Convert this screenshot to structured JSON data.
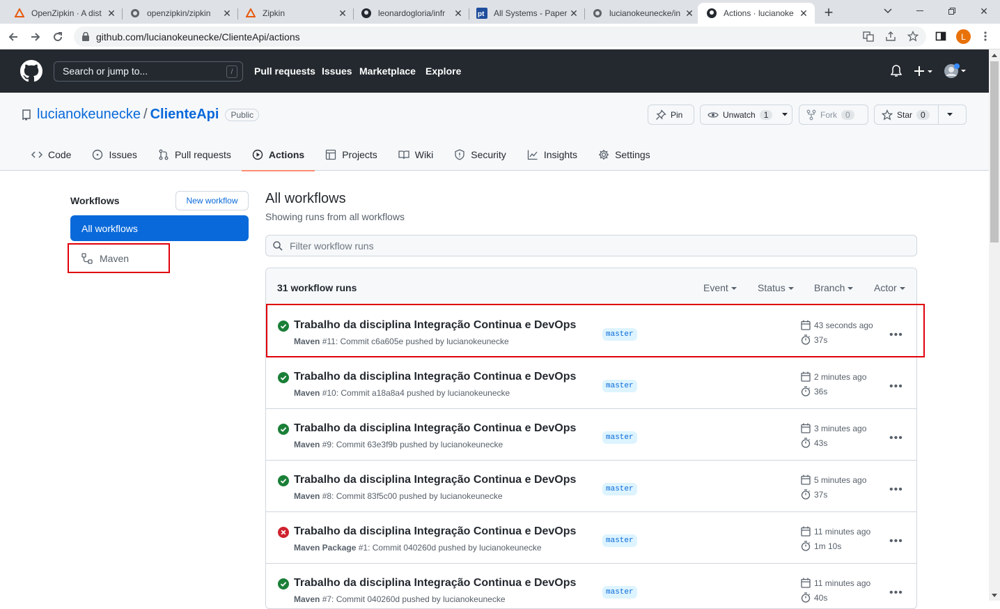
{
  "browser": {
    "tabs": [
      {
        "title": "OpenZipkin · A dist",
        "icon": "zipkin-icon"
      },
      {
        "title": "openzipkin/zipkin",
        "icon": "globe-icon"
      },
      {
        "title": "Zipkin",
        "icon": "zipkin-icon"
      },
      {
        "title": "leonardogloria/infr",
        "icon": "github-icon"
      },
      {
        "title": "All Systems - Paper",
        "icon": "pt-icon"
      },
      {
        "title": "lucianokeunecke/in",
        "icon": "globe-icon"
      },
      {
        "title": "Actions · lucianoke",
        "icon": "github-icon",
        "active": true
      }
    ],
    "url": "github.com/lucianokeunecke/ClienteApi/actions",
    "profile_initial": "L"
  },
  "gh_header": {
    "search_placeholder": "Search or jump to...",
    "search_shortcut": "/",
    "nav": [
      "Pull requests",
      "Issues",
      "Marketplace",
      "Explore"
    ]
  },
  "repo": {
    "owner": "lucianokeunecke",
    "separator": "/",
    "name": "ClienteApi",
    "visibility": "Public",
    "pin_label": "Pin",
    "unwatch_label": "Unwatch",
    "watch_count": "1",
    "fork_label": "Fork",
    "fork_count": "0",
    "star_label": "Star",
    "star_count": "0",
    "tabs": [
      "Code",
      "Issues",
      "Pull requests",
      "Actions",
      "Projects",
      "Wiki",
      "Security",
      "Insights",
      "Settings"
    ],
    "active_tab": "Actions"
  },
  "sidebar": {
    "title": "Workflows",
    "new_workflow": "New workflow",
    "items": [
      "All workflows",
      "Maven"
    ]
  },
  "main": {
    "title": "All workflows",
    "subtitle": "Showing runs from all workflows",
    "filter_placeholder": "Filter workflow runs",
    "runs_count": "31 workflow runs",
    "filters": [
      "Event",
      "Status",
      "Branch",
      "Actor"
    ],
    "runs": [
      {
        "status": "success",
        "title": "Trabalho da disciplina Integração Continua e DevOps",
        "workflow": "Maven",
        "detail": " #11: Commit c6a605e pushed by lucianokeunecke",
        "branch": "master",
        "when": "43 seconds ago",
        "duration": "37s"
      },
      {
        "status": "success",
        "title": "Trabalho da disciplina Integração Continua e DevOps",
        "workflow": "Maven",
        "detail": " #10: Commit a18a8a4 pushed by lucianokeunecke",
        "branch": "master",
        "when": "2 minutes ago",
        "duration": "36s"
      },
      {
        "status": "success",
        "title": "Trabalho da disciplina Integração Continua e DevOps",
        "workflow": "Maven",
        "detail": " #9: Commit 63e3f9b pushed by lucianokeunecke",
        "branch": "master",
        "when": "3 minutes ago",
        "duration": "43s"
      },
      {
        "status": "success",
        "title": "Trabalho da disciplina Integração Continua e DevOps",
        "workflow": "Maven",
        "detail": " #8: Commit 83f5c00 pushed by lucianokeunecke",
        "branch": "master",
        "when": "5 minutes ago",
        "duration": "37s"
      },
      {
        "status": "failure",
        "title": "Trabalho da disciplina Integração Continua e DevOps",
        "workflow": "Maven Package",
        "detail": " #1: Commit 040260d pushed by lucianokeunecke",
        "branch": "master",
        "when": "11 minutes ago",
        "duration": "1m 10s"
      },
      {
        "status": "success",
        "title": "Trabalho da disciplina Integração Continua e DevOps",
        "workflow": "Maven",
        "detail": " #7: Commit 040260d pushed by lucianokeunecke",
        "branch": "master",
        "when": "11 minutes ago",
        "duration": "40s"
      }
    ]
  },
  "colors": {
    "success": "#1a7f37",
    "failure": "#cf222e",
    "accent": "#0969da",
    "highlight": "#e0000a"
  }
}
